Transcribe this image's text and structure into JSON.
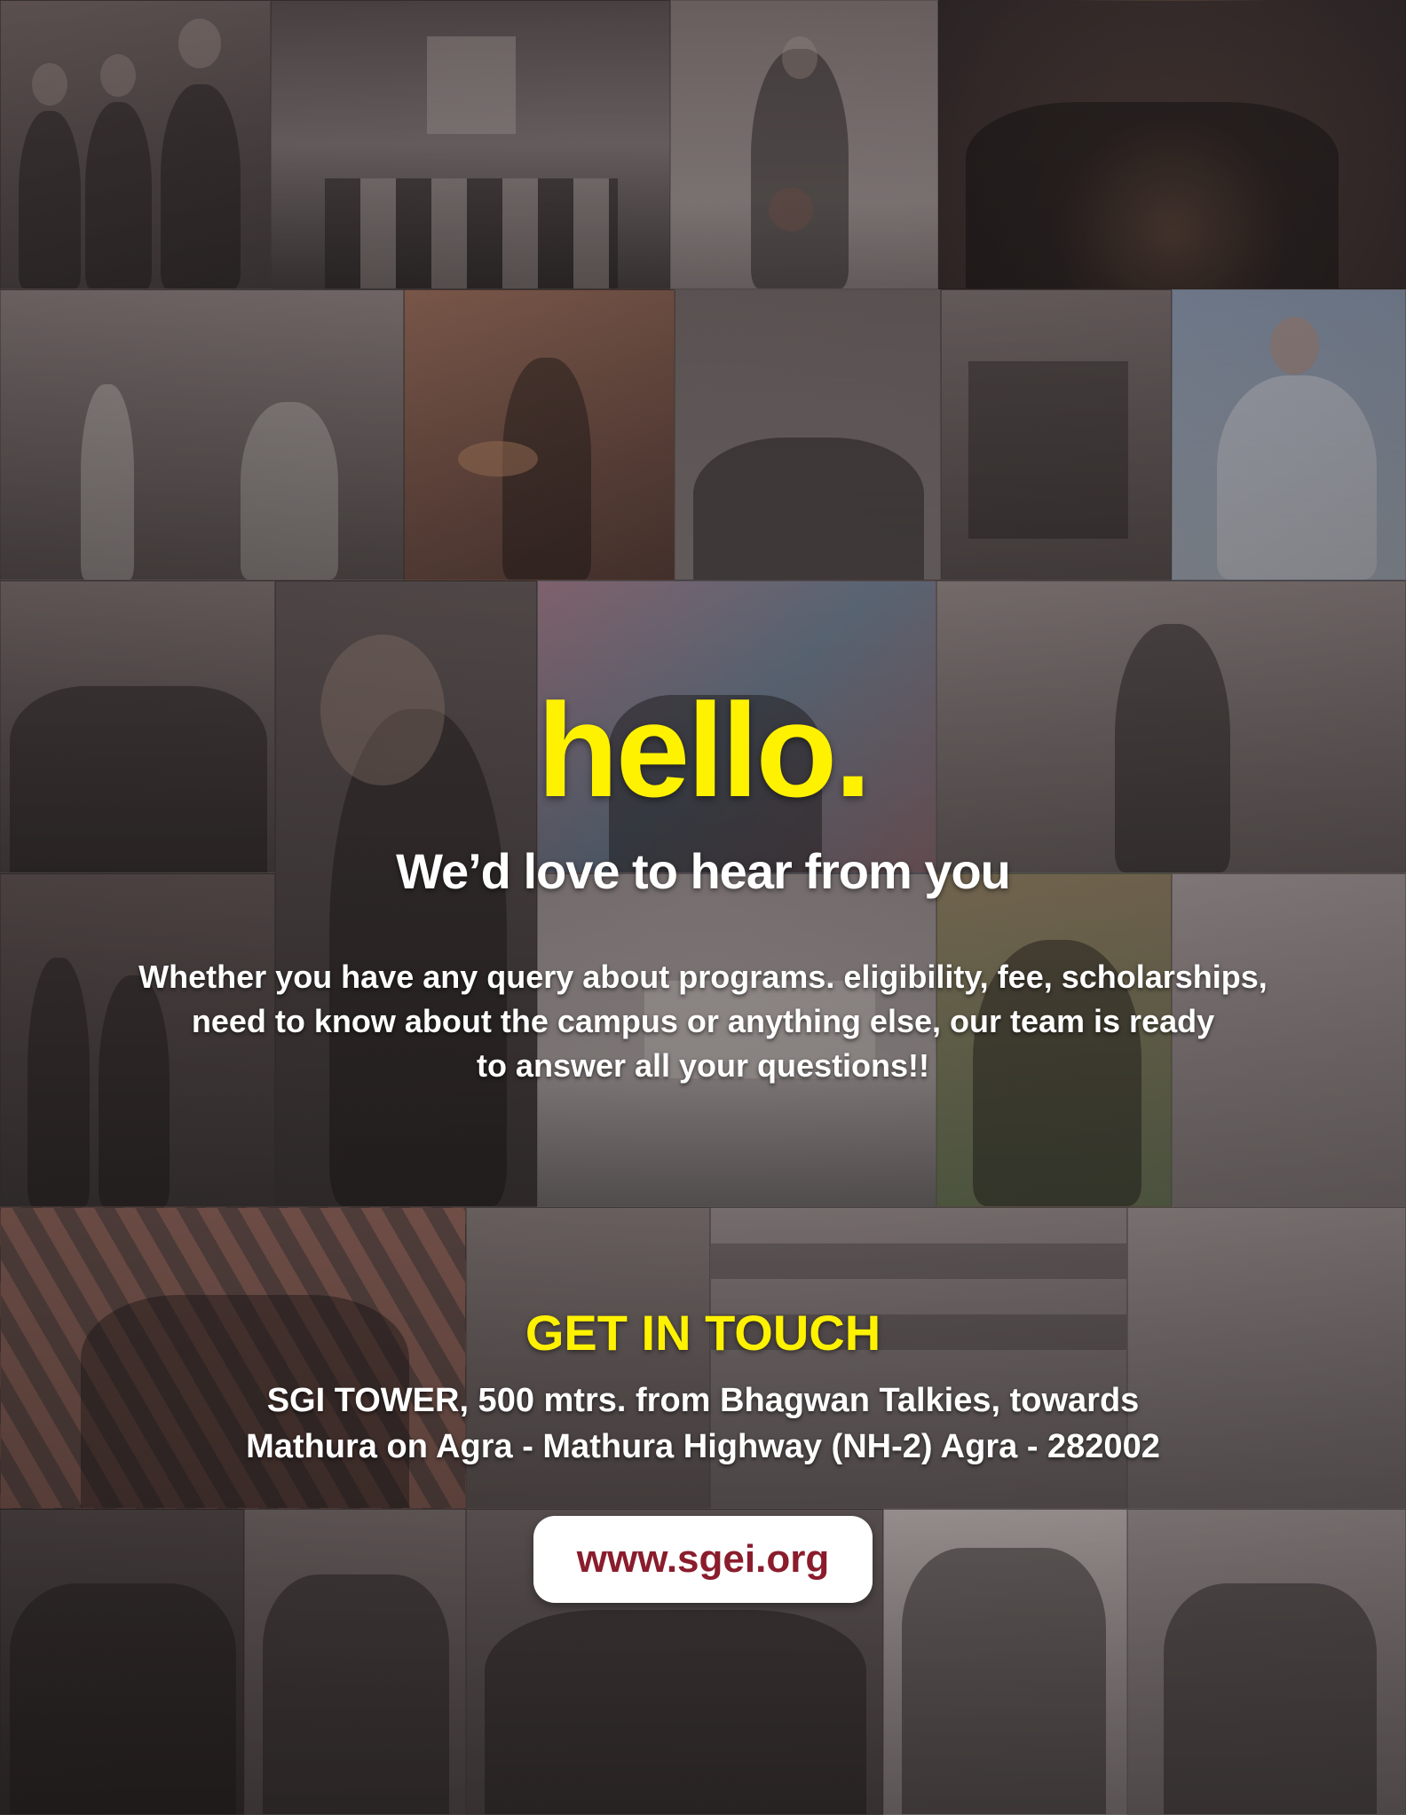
{
  "poster": {
    "headline": "hello.",
    "subhead": "We’d love to hear from you",
    "body_line_1": "Whether you have any query about programs. eligibility, fee, scholarships,",
    "body_line_2": "need to know about the campus or anything else, our team is ready",
    "body_line_3": "to answer all your questions!!",
    "cta_title": "GET IN TOUCH",
    "address_line_1": "SGI TOWER, 500 mtrs. from Bhagwan Talkies, towards",
    "address_line_2": "Mathura on Agra - Mathura Highway (NH-2) Agra - 282002",
    "website": "www.sgei.org"
  },
  "colors": {
    "headline": "#fff200",
    "text": "#ffffff",
    "url_text": "#8a1c2c",
    "url_background": "#ffffff",
    "photo_tone": "#6b6061"
  }
}
